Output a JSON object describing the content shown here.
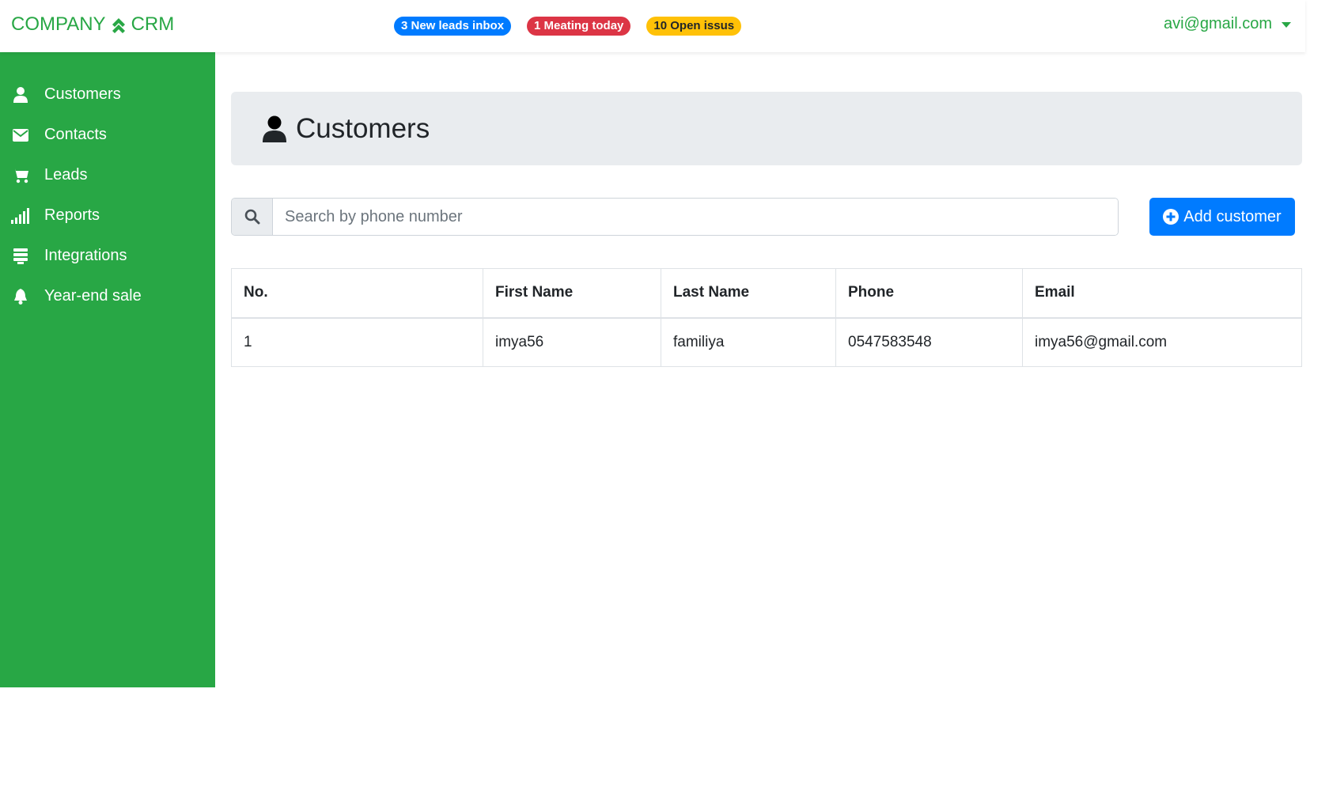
{
  "brand": {
    "left_text": "COMPANY",
    "right_text": "CRM",
    "icon": "chevrons-up-icon"
  },
  "badges": [
    {
      "label": "3 New leads inbox",
      "color": "#007bff"
    },
    {
      "label": "1 Meating today",
      "color": "#dc3545"
    },
    {
      "label": "10 Open issus",
      "color": "#ffc107"
    }
  ],
  "user": {
    "email": "avi@gmail.com"
  },
  "sidebar": {
    "items": [
      {
        "label": "Customers",
        "icon": "user-icon"
      },
      {
        "label": "Contacts",
        "icon": "envelope-icon"
      },
      {
        "label": "Leads",
        "icon": "cart-icon"
      },
      {
        "label": "Reports",
        "icon": "signal-bars-icon"
      },
      {
        "label": "Integrations",
        "icon": "list-icon"
      },
      {
        "label": "Year-end sale",
        "icon": "bell-icon"
      }
    ]
  },
  "page": {
    "title": "Customers",
    "icon": "user-icon"
  },
  "search": {
    "placeholder": "Search by phone number",
    "value": ""
  },
  "add_button": {
    "label": "Add customer"
  },
  "table": {
    "headers": [
      "No.",
      "First Name",
      "Last Name",
      "Phone",
      "Email"
    ],
    "rows": [
      [
        "1",
        "imya56",
        "familiya",
        "0547583548",
        "imya56@gmail.com"
      ]
    ]
  },
  "colors": {
    "accent_green": "#28a745",
    "primary_blue": "#007bff",
    "header_bg": "#e9ecef"
  }
}
